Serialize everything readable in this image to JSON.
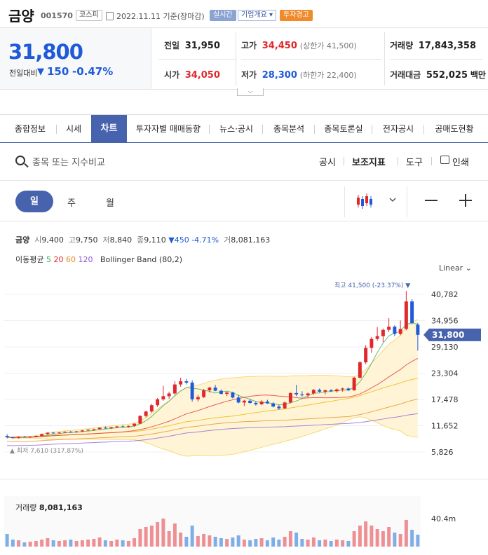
{
  "header": {
    "name": "금양",
    "code": "001570",
    "market": "코스피",
    "date": "2022.11.11 기준(장마감)",
    "realtime": "실시간",
    "company_info": "기업개요 ▾",
    "warning": "투자경고"
  },
  "price": {
    "current": "31,800",
    "prev_label": "전일대비",
    "change_arrow": "▼",
    "change": "150",
    "change_pct": "-0.47%"
  },
  "quote": {
    "prev_close_label": "전일",
    "prev_close": "31,950",
    "high_label": "고가",
    "high": "34,450",
    "upper_limit": "(상한가 41,500)",
    "volume_label": "거래량",
    "volume": "17,843,358",
    "open_label": "시가",
    "open": "34,050",
    "low_label": "저가",
    "low": "28,300",
    "lower_limit": "(하한가 22,400)",
    "amount_label": "거래대금",
    "amount": "552,025",
    "amount_unit": "백만"
  },
  "tabs": [
    "종합정보",
    "시세",
    "차트",
    "투자자별 매매동향",
    "뉴스·공시",
    "종목분석",
    "종목토론실",
    "전자공시",
    "공매도현황"
  ],
  "toolbar": {
    "search_placeholder": "종목 또는 지수비교",
    "disclosure": "공시",
    "indicators": "보조지표",
    "tools": "도구",
    "print": "인쇄"
  },
  "period": {
    "day": "일",
    "week": "주",
    "month": "월"
  },
  "ohlc": {
    "name": "금양",
    "open_label": "시",
    "open": "9,400",
    "high_label": "고",
    "high": "9,750",
    "low_label": "저",
    "low": "8,840",
    "close_label": "종",
    "close": "9,110",
    "change": "▼450 -4.71%",
    "vol_label": "거",
    "vol": "8,081,163"
  },
  "indicators": {
    "ma_label": "이동평균",
    "ma5": "5",
    "ma20": "20",
    "ma60": "60",
    "ma120": "120",
    "bb": "Bollinger Band (80,2)"
  },
  "scale_mode": "Linear",
  "chart_labels": {
    "max": "최고 41,500 (-23.37%)",
    "min": "최저 7,610 (317.87%)",
    "last": "31,800"
  },
  "volume_label": "거래량",
  "volume_value": "8,081,163",
  "colors": {
    "up": "#e0282b",
    "down": "#1f5bd8",
    "accent": "#4863ae"
  },
  "chart_data": {
    "type": "candlestick",
    "yticks": [
      "40,782",
      "34,956",
      "29,130",
      "23,304",
      "17,478",
      "11,652",
      "5,826"
    ],
    "ytick_values": [
      40782,
      34956,
      29130,
      23304,
      17478,
      11652,
      5826
    ],
    "volume_tick": "40.4m",
    "candles": [
      [
        9400,
        9750,
        8840,
        9110
      ],
      [
        9100,
        9200,
        8700,
        8950
      ],
      [
        8950,
        9300,
        8800,
        9200
      ],
      [
        9200,
        9400,
        9000,
        9100
      ],
      [
        9100,
        9300,
        8900,
        9250
      ],
      [
        9250,
        9500,
        9100,
        9400
      ],
      [
        9400,
        9900,
        9300,
        9800
      ],
      [
        9800,
        10200,
        9600,
        10100
      ],
      [
        10100,
        10300,
        9900,
        10000
      ],
      [
        10000,
        10200,
        9800,
        10150
      ],
      [
        10150,
        10400,
        10000,
        10300
      ],
      [
        10300,
        10500,
        10100,
        10250
      ],
      [
        10250,
        10500,
        10100,
        10400
      ],
      [
        10400,
        10700,
        10200,
        10600
      ],
      [
        10600,
        10900,
        10400,
        10750
      ],
      [
        10750,
        11000,
        10500,
        10900
      ],
      [
        10900,
        11300,
        10700,
        11200
      ],
      [
        11200,
        11500,
        11000,
        11100
      ],
      [
        11100,
        11400,
        10900,
        11300
      ],
      [
        11300,
        11600,
        11100,
        11500
      ],
      [
        11500,
        11800,
        11300,
        11400
      ],
      [
        11400,
        11700,
        11200,
        11600
      ],
      [
        11600,
        12200,
        11400,
        12100
      ],
      [
        12100,
        14000,
        12000,
        13800
      ],
      [
        13800,
        15000,
        13500,
        14800
      ],
      [
        14800,
        16500,
        14500,
        16200
      ],
      [
        16200,
        17800,
        15800,
        17500
      ],
      [
        17500,
        20500,
        17200,
        18200
      ],
      [
        18200,
        19200,
        17600,
        18800
      ],
      [
        18800,
        21500,
        18500,
        20800
      ],
      [
        20800,
        22300,
        20300,
        21500
      ],
      [
        21500,
        22000,
        20800,
        21200
      ],
      [
        21200,
        21700,
        17000,
        17500
      ],
      [
        17500,
        18500,
        17000,
        18000
      ],
      [
        18000,
        19800,
        17800,
        19500
      ],
      [
        19500,
        20300,
        19000,
        20100
      ],
      [
        20100,
        20700,
        19300,
        19400
      ],
      [
        19400,
        19700,
        18600,
        18700
      ],
      [
        18700,
        19300,
        18200,
        19000
      ],
      [
        19000,
        19200,
        17700,
        17900
      ],
      [
        17900,
        18500,
        16600,
        16800
      ],
      [
        16800,
        17400,
        16000,
        17200
      ],
      [
        17200,
        17600,
        16500,
        16700
      ],
      [
        16700,
        17100,
        16100,
        16400
      ],
      [
        16400,
        17300,
        16200,
        17000
      ],
      [
        17000,
        17400,
        16500,
        16600
      ],
      [
        16600,
        16900,
        15700,
        15900
      ],
      [
        15900,
        16300,
        15200,
        15500
      ],
      [
        15500,
        17000,
        15300,
        16800
      ],
      [
        16800,
        19000,
        16600,
        18900
      ],
      [
        18900,
        20700,
        18200,
        18600
      ],
      [
        18600,
        19300,
        18000,
        18400
      ],
      [
        18400,
        19000,
        17900,
        18800
      ],
      [
        18800,
        19800,
        18500,
        19600
      ],
      [
        19600,
        19900,
        19000,
        19200
      ],
      [
        19200,
        19700,
        18600,
        19500
      ],
      [
        19500,
        19800,
        19100,
        19300
      ],
      [
        19300,
        19900,
        19000,
        19700
      ],
      [
        19700,
        20100,
        19200,
        19900
      ],
      [
        19900,
        20100,
        19300,
        19500
      ],
      [
        19500,
        22500,
        19400,
        22300
      ],
      [
        22300,
        26000,
        22100,
        25700
      ],
      [
        25700,
        29500,
        25300,
        28900
      ],
      [
        28900,
        31300,
        27800,
        30900
      ],
      [
        30900,
        33500,
        30500,
        31500
      ],
      [
        31500,
        33200,
        30200,
        32900
      ],
      [
        32900,
        35500,
        32400,
        33600
      ],
      [
        33600,
        33900,
        31500,
        32000
      ],
      [
        32000,
        35000,
        31700,
        33100
      ],
      [
        33100,
        41500,
        32800,
        39200
      ],
      [
        39200,
        39700,
        34100,
        34400
      ],
      [
        34050,
        34450,
        28300,
        31800
      ]
    ],
    "volumes": [
      18,
      10,
      9,
      6,
      7,
      8,
      10,
      12,
      9,
      8,
      9,
      10,
      8,
      9,
      10,
      11,
      13,
      9,
      8,
      10,
      9,
      8,
      12,
      25,
      28,
      30,
      35,
      40,
      22,
      33,
      20,
      14,
      30,
      15,
      18,
      16,
      14,
      12,
      11,
      13,
      16,
      10,
      9,
      11,
      12,
      9,
      13,
      10,
      14,
      22,
      20,
      11,
      10,
      13,
      9,
      10,
      8,
      10,
      9,
      8,
      22,
      30,
      36,
      30,
      25,
      22,
      28,
      20,
      18,
      38,
      24,
      17
    ]
  }
}
